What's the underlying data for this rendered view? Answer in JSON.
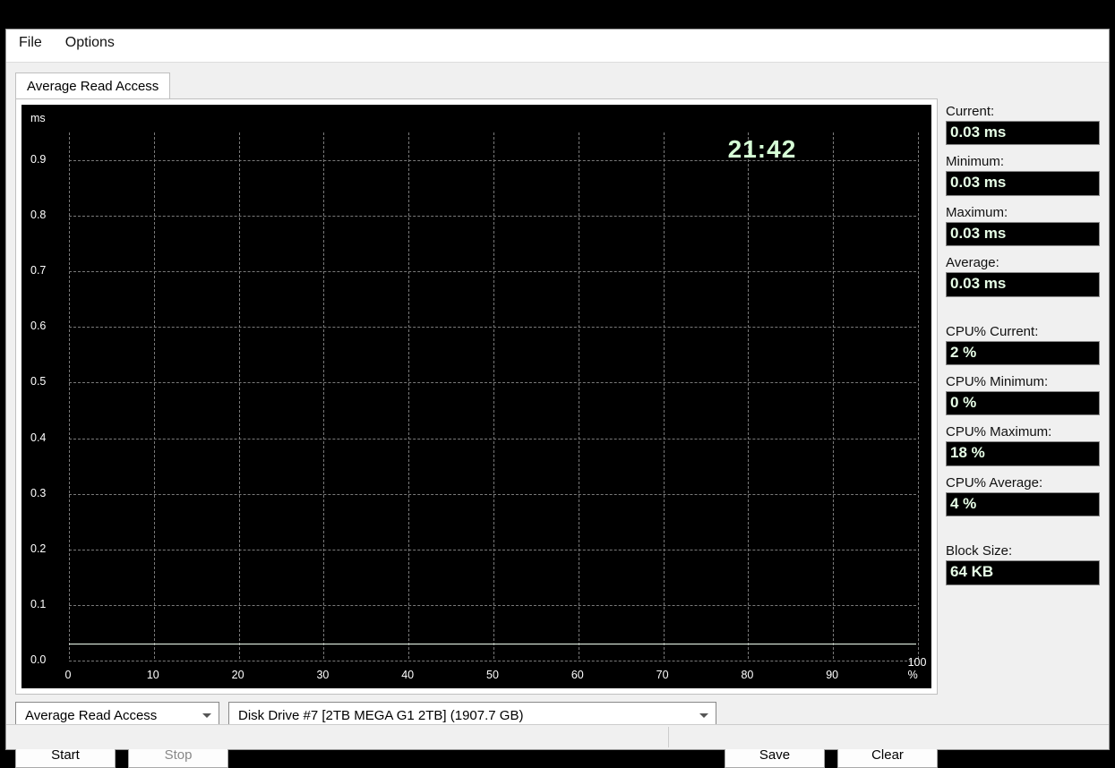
{
  "menu": {
    "file": "File",
    "options": "Options"
  },
  "tab": {
    "label": "Average Read Access"
  },
  "chart_data": {
    "type": "line",
    "y_unit": "ms",
    "y_ticks": [
      "0.0",
      "0.1",
      "0.2",
      "0.3",
      "0.4",
      "0.5",
      "0.6",
      "0.7",
      "0.8",
      "0.9"
    ],
    "x_ticks": [
      "0",
      "10",
      "20",
      "30",
      "40",
      "50",
      "60",
      "70",
      "80",
      "90",
      "100 %"
    ],
    "x": [
      0,
      10,
      20,
      30,
      40,
      50,
      60,
      70,
      80,
      90,
      100
    ],
    "values": [
      0.03,
      0.03,
      0.03,
      0.03,
      0.03,
      0.03,
      0.03,
      0.03,
      0.03,
      0.03,
      0.03
    ],
    "ylim": [
      0.0,
      0.95
    ],
    "xlabel": "",
    "ylabel": "ms",
    "title": "",
    "elapsed_clock": "21:42"
  },
  "stats": {
    "current_label": "Current:",
    "current_value": "0.03 ms",
    "minimum_label": "Minimum:",
    "minimum_value": "0.03 ms",
    "maximum_label": "Maximum:",
    "maximum_value": "0.03 ms",
    "average_label": "Average:",
    "average_value": "0.03 ms",
    "cpu_current_label": "CPU% Current:",
    "cpu_current_value": "2 %",
    "cpu_minimum_label": "CPU% Minimum:",
    "cpu_minimum_value": "0 %",
    "cpu_maximum_label": "CPU% Maximum:",
    "cpu_maximum_value": "18 %",
    "cpu_average_label": "CPU% Average:",
    "cpu_average_value": "4 %",
    "block_size_label": "Block Size:",
    "block_size_value": "64 KB"
  },
  "controls": {
    "test_type_selected": "Average Read Access",
    "drive_selected": "Disk Drive #7  [2TB MEGA G1 2TB]  (1907.7 GB)",
    "start": "Start",
    "stop": "Stop",
    "save": "Save",
    "clear": "Clear"
  }
}
